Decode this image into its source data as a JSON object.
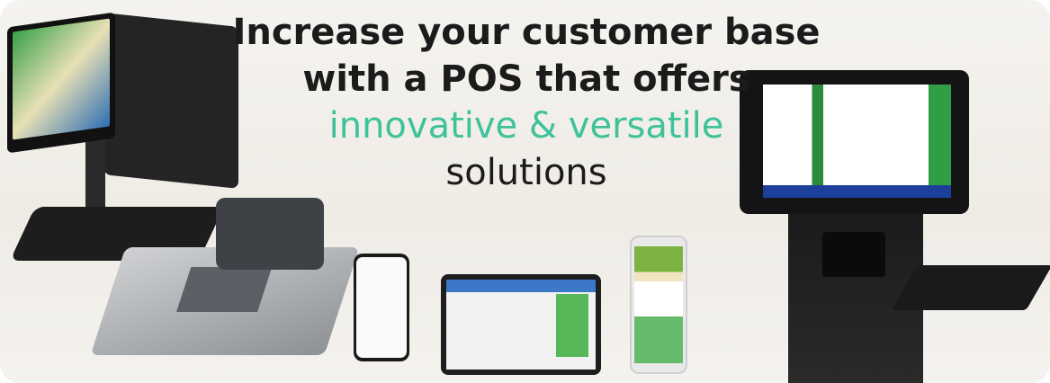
{
  "headline": {
    "line1": "Increase your customer base",
    "line2": "with a POS that offers",
    "line3": "innovative & versatile",
    "line4": "solutions"
  },
  "colors": {
    "accent": "#3ec29a",
    "text": "#1b1b1b",
    "background": "#f2f0ec"
  }
}
